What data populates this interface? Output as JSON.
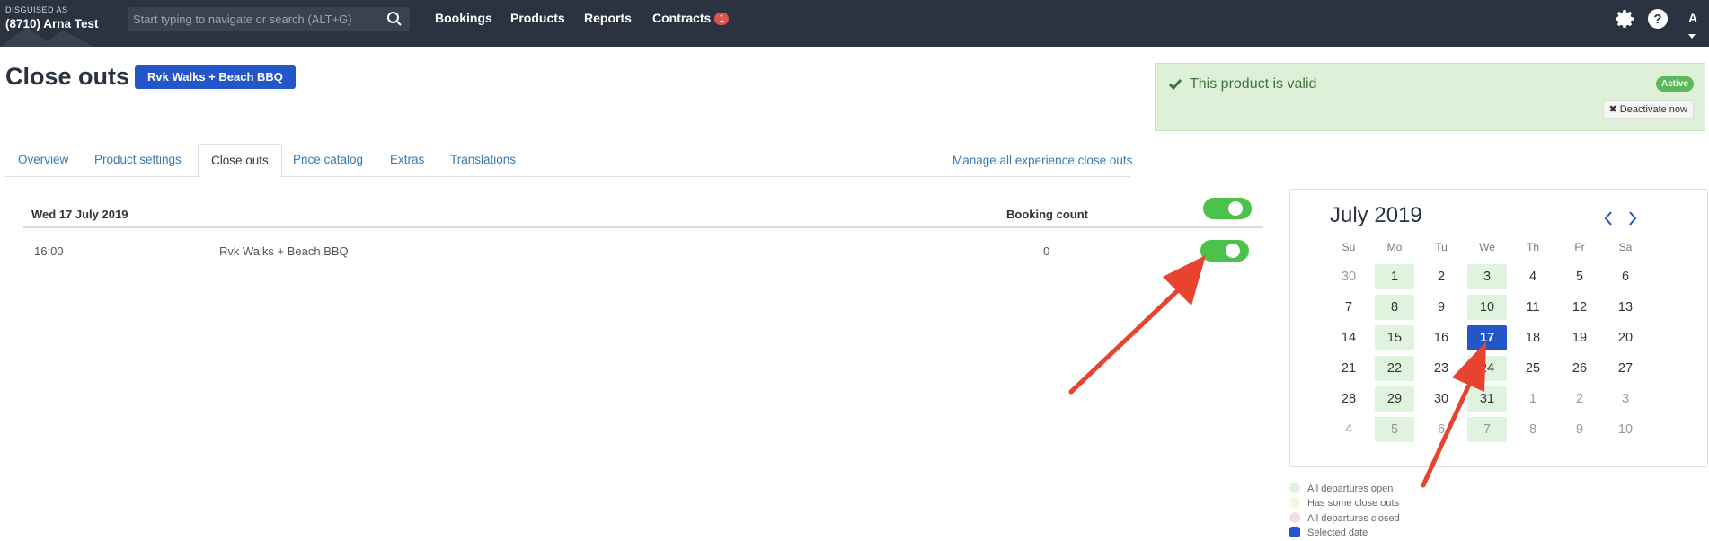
{
  "topbar": {
    "disguised_label": "DISGUISED AS",
    "account_name": "(8710) Arna Test",
    "search_placeholder": "Start typing to navigate or search (ALT+G)",
    "nav": [
      "Bookings",
      "Products",
      "Reports",
      "Contracts"
    ],
    "contracts_badge": "1",
    "avatar_initial": "A"
  },
  "header": {
    "title": "Close outs",
    "product_button": "Rvk Walks + Beach BBQ"
  },
  "validity": {
    "message": "This product is valid",
    "status": "Active",
    "deactivate_label": "Deactivate now"
  },
  "tabs": [
    "Overview",
    "Product settings",
    "Close outs",
    "Price catalog",
    "Extras",
    "Translations"
  ],
  "active_tab": "Close outs",
  "manage_link": "Manage all experience close outs",
  "table": {
    "date_header": "Wed 17 July 2019",
    "count_header": "Booking count",
    "rows": [
      {
        "time": "16:00",
        "product": "Rvk Walks + Beach BBQ",
        "count": "0",
        "open": true
      }
    ],
    "all_open": true
  },
  "calendar": {
    "month": "July 2019",
    "weekdays": [
      "Su",
      "Mo",
      "Tu",
      "We",
      "Th",
      "Fr",
      "Sa"
    ],
    "weeks": [
      [
        "30",
        "1",
        "2",
        "3",
        "4",
        "5",
        "6"
      ],
      [
        "7",
        "8",
        "9",
        "10",
        "11",
        "12",
        "13"
      ],
      [
        "14",
        "15",
        "16",
        "17",
        "18",
        "19",
        "20"
      ],
      [
        "21",
        "22",
        "23",
        "24",
        "25",
        "26",
        "27"
      ],
      [
        "28",
        "29",
        "30",
        "31",
        "1",
        "2",
        "3"
      ],
      [
        "4",
        "5",
        "6",
        "7",
        "8",
        "9",
        "10"
      ]
    ],
    "selected_day": "17"
  },
  "legend": [
    "All departures open",
    "Has some close outs",
    "All departures closed",
    "Selected date"
  ],
  "colors": {
    "topbar": "#2b3240",
    "accent": "#2356c9",
    "toggle_on": "#4cc24a",
    "open_day": "#dff3df",
    "some_closed": "#fcf3e0",
    "all_closed": "#f6dede",
    "annotation_arrow": "#e8432f"
  }
}
